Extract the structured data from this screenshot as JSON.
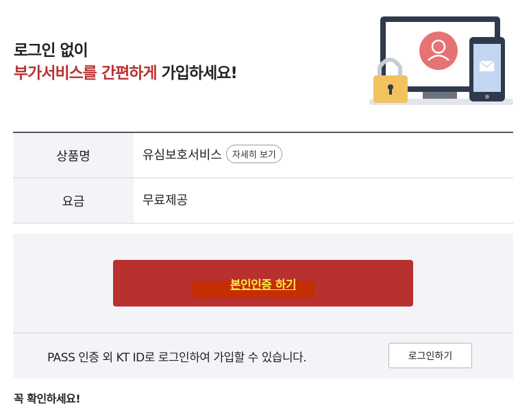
{
  "header": {
    "line1": "로그인 없이",
    "line2_accent": "부가서비스를 간편하게",
    "line2_rest": " 가입하세요!"
  },
  "product": {
    "rows": [
      {
        "label": "상품명",
        "value": "유심보호서비스"
      },
      {
        "label": "요금",
        "value": "무료제공"
      }
    ],
    "detail_button": "자세히 보기"
  },
  "verification": {
    "button_label": "본인인증 하기",
    "alt_text": "PASS 인증 외 KT ID로 로그인하여 가입할 수 있습니다.",
    "login_button": "로그인하기"
  },
  "notice": {
    "title": "꼭 확인하세요!"
  },
  "colors": {
    "accent": "#b8312f",
    "button_text": "#ffe94a",
    "panel_bg": "#f3f4f8"
  },
  "icons": [
    "padlock-icon",
    "monitor-icon",
    "user-avatar-icon",
    "smartphone-icon",
    "envelope-icon"
  ]
}
